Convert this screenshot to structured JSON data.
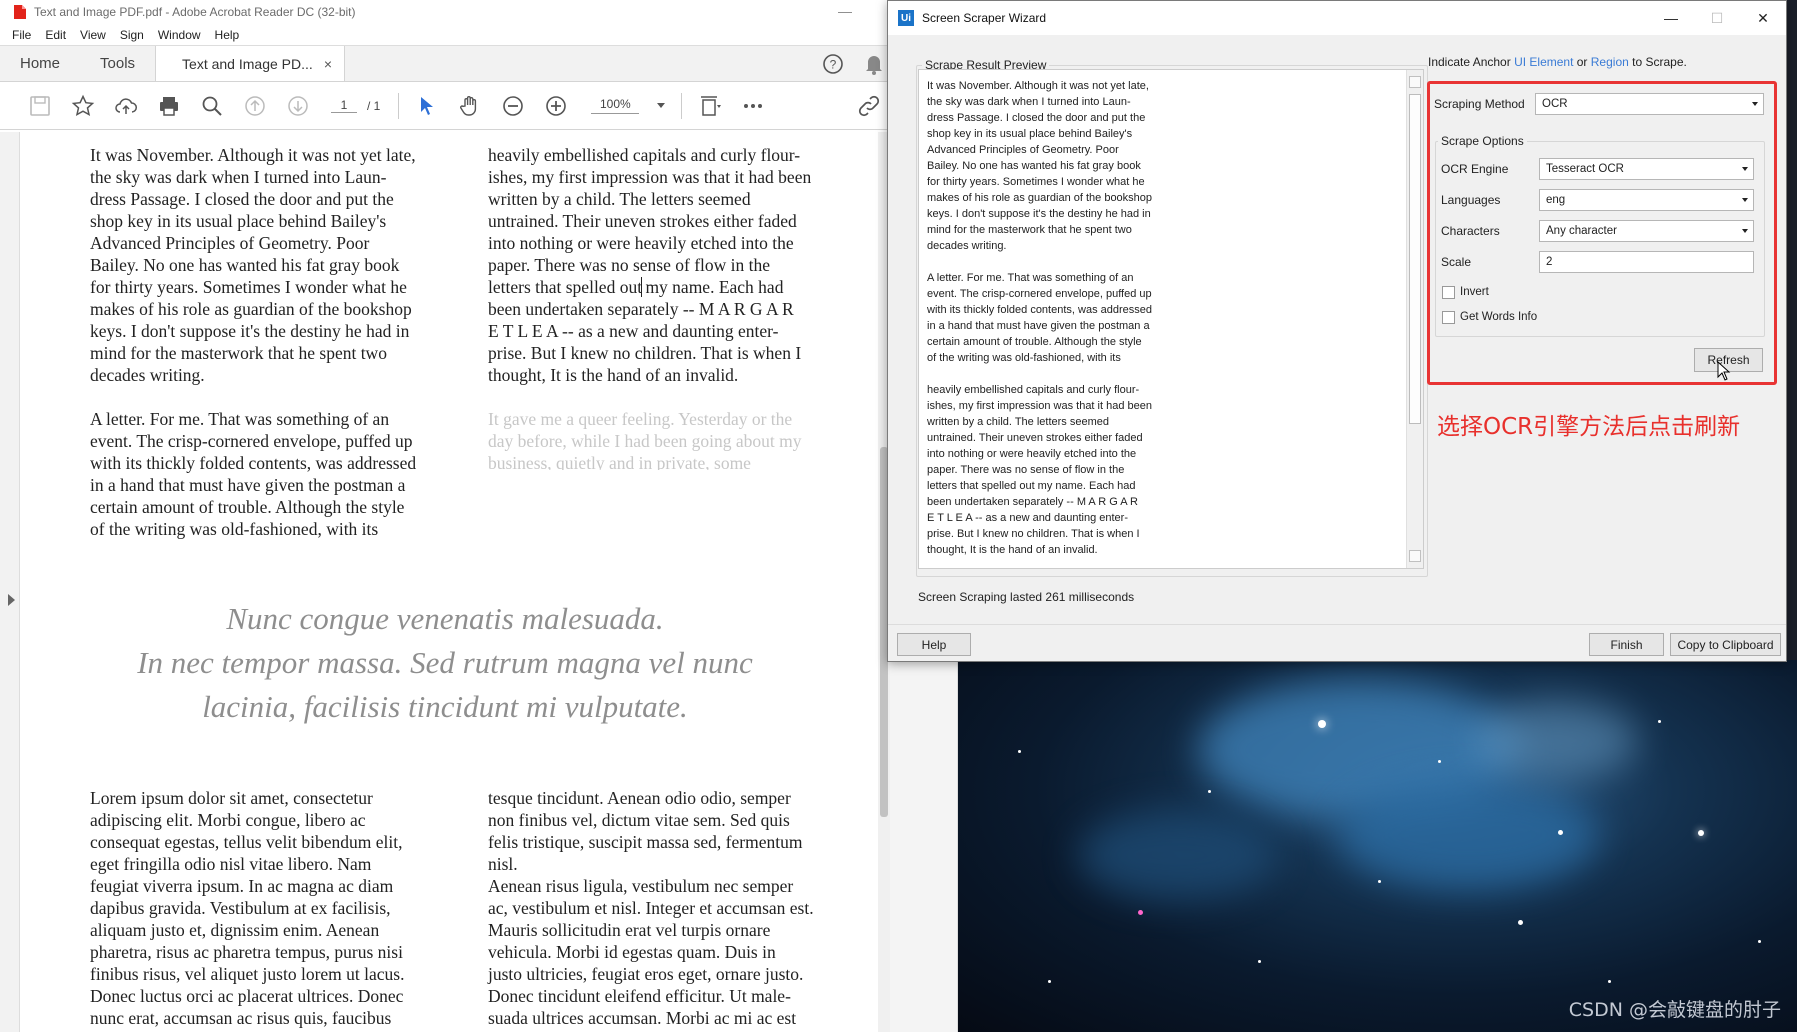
{
  "acrobat": {
    "title": "Text and Image PDF.pdf - Adobe Acrobat Reader DC (32-bit)",
    "menu": [
      "File",
      "Edit",
      "View",
      "Sign",
      "Window",
      "Help"
    ],
    "tabs": {
      "home": "Home",
      "tools": "Tools",
      "doc": "Text and Image PD...",
      "close": "×"
    },
    "page": {
      "current": "1",
      "total": "/ 1"
    },
    "zoom": "100%",
    "doc": {
      "col1a": "It was November. Although it was not yet late,\nthe sky was dark when I turned into Laun-\ndress Passage. I closed the door and put the\nshop key in its usual place behind Bailey's\nAdvanced Principles of Geometry. Poor\nBailey. No one has wanted his fat gray book\nfor thirty years. Sometimes I wonder what he\nmakes of his role as guardian of the bookshop\nkeys. I don't suppose it's the destiny he had in\nmind for the masterwork that he spent two\ndecades writing.",
      "col1b": "A letter. For me. That was something of an\nevent. The crisp-cornered envelope, puffed up\nwith its thickly folded contents, was addressed\nin a hand that must have given the postman a\ncertain amount of trouble. Although the style\nof the writing was old-fashioned, with its",
      "col2a_pre": "heavily embellished capitals and curly flour-\nishes, my first impression was that it had been\nwritten by a child. The letters seemed\nuntrained. Their uneven strokes either faded\ninto nothing or were heavily etched into the\npaper. There was no sense of flow in the\nletters that spelled out",
      "col2a_post": " my name. Each had\nbeen undertaken separately -- M A R G A R\nE T L E A -- as a new and daunting enter-\nprise. But I knew no children. That is when I\nthought, It is the hand of an invalid.",
      "col2b": "It gave me a queer feeling. Yesterday or the\nday before, while I had been going about my\nbusiness, quietly and in private, some",
      "quote": "Nunc congue venenatis malesuada.\nIn nec tempor massa. Sed rutrum magna vel nunc\nlacinia, facilisis tincidunt mi vulputate.",
      "col1c": "Lorem ipsum dolor sit amet, consectetur\nadipiscing elit. Morbi congue, libero ac\nconsequat egestas, tellus velit bibendum elit,\neget fringilla odio nisl vitae libero. Nam\nfeugiat viverra ipsum. In ac magna ac diam\ndapibus gravida. Vestibulum at ex facilisis,\naliquam justo et, dignissim enim. Aenean\npharetra, risus ac pharetra tempus, purus nisi\nfinibus risus, vel aliquet justo lorem ut lacus.\nDonec luctus orci ac placerat ultrices. Donec\nnunc erat, accumsan ac risus quis, faucibus",
      "col2c": "tesque tincidunt. Aenean odio odio, semper\nnon finibus vel, dictum vitae sem. Sed quis\nfelis tristique, suscipit massa sed, fermentum\nnisl.\nAenean risus ligula, vestibulum nec semper\nac, vestibulum et nisl. Integer et accumsan est.\nMauris sollicitudin erat vel turpis ornare\nvehicula. Morbi id egestas quam. Duis in\njusto ultricies, feugiat eros eget, ornare justo.\nDonec tincidunt eleifend efficitur. Ut male-\nsuada ultrices accumsan. Morbi ac mi ac est"
    }
  },
  "wizard": {
    "title": "Screen Scraper Wizard",
    "icon_text": "Ui",
    "win_controls": {
      "min": "—",
      "max": "☐",
      "close": "✕"
    },
    "preview_label": "Scrape Result Preview",
    "preview_text": "It was November. Although it was not yet late,\nthe sky was dark when I turned into Laun-\ndress Passage. I closed the door and put the\nshop key in its usual place behind Bailey's\nAdvanced Principles of Geometry. Poor\nBailey. No one has wanted his fat gray book\nfor thirty years. Sometimes I wonder what he\nmakes of his role as guardian of the bookshop\nkeys. I don't suppose it's the destiny he had in\nmind for the masterwork that he spent two\ndecades writing.\n\nA letter. For me. That was something of an\nevent. The crisp-cornered envelope, puffed up\nwith its thickly folded contents, was addressed\nin a hand that must have given the postman a\ncertain amount of trouble. Although the style\nof the writing was old-fashioned, with its\n\nheavily embellished capitals and curly flour-\nishes, my first impression was that it had been\nwritten by a child. The letters seemed\nuntrained. Their uneven strokes either faded\ninto nothing or were heavily etched into the\npaper. There was no sense of flow in the\nletters that spelled out my name. Each had\nbeen undertaken separately -- M A R G A R\nE T L E A -- as a new and daunting enter-\nprise. But I knew no children. That is when I\nthought, It is the hand of an invalid.",
    "status": "Screen Scraping lasted 261 milliseconds",
    "anchor": {
      "pre": "Indicate Anchor ",
      "ui": "UI Element",
      "or": " or ",
      "region": "Region",
      "post": " to Scrape."
    },
    "scraping_method_label": "Scraping Method",
    "scraping_method": "OCR",
    "options_label": "Scrape Options",
    "ocr_engine_label": "OCR Engine",
    "ocr_engine": "Tesseract OCR",
    "languages_label": "Languages",
    "languages": "eng",
    "characters_label": "Characters",
    "characters": "Any character",
    "scale_label": "Scale",
    "scale": "2",
    "invert_label": "Invert",
    "words_label": "Get Words Info",
    "refresh": "Refresh",
    "help": "Help",
    "finish": "Finish",
    "copy": "Copy to Clipboard",
    "annotation": "选择OCR引擎方法后点击刷新",
    "accent": "#e83434"
  },
  "watermark": "CSDN @会敲键盘的肘子"
}
